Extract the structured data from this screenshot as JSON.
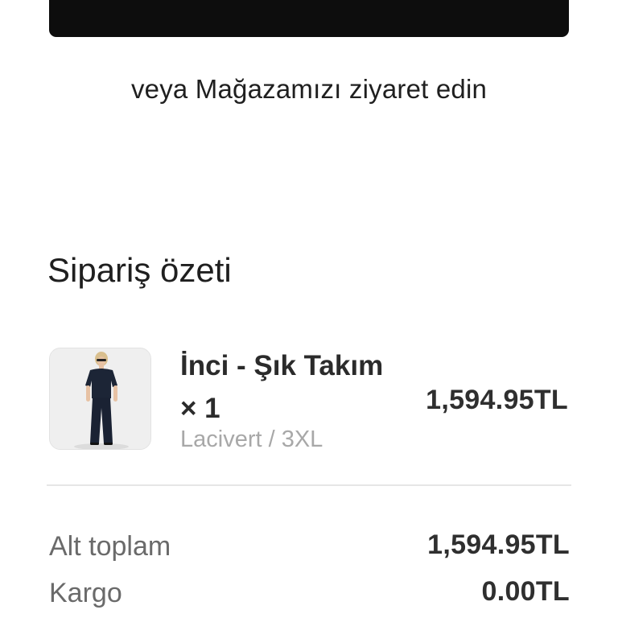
{
  "checkout": {
    "visit_store_text": "veya Mağazamızı ziyaret edin"
  },
  "order_summary": {
    "title": "Sipariş özeti",
    "item": {
      "name": "İnci - Şık Takım × 1",
      "variant": "Lacivert / 3XL",
      "price": "1,594.95TL",
      "image_icon": "product-photo-navy-outfit"
    },
    "subtotal_label": "Alt toplam",
    "subtotal_value": "1,594.95TL",
    "shipping_label": "Kargo",
    "shipping_value": "0.00TL"
  },
  "colors": {
    "primary_button": "#0d0d0d",
    "outfit": "#1c2536"
  }
}
